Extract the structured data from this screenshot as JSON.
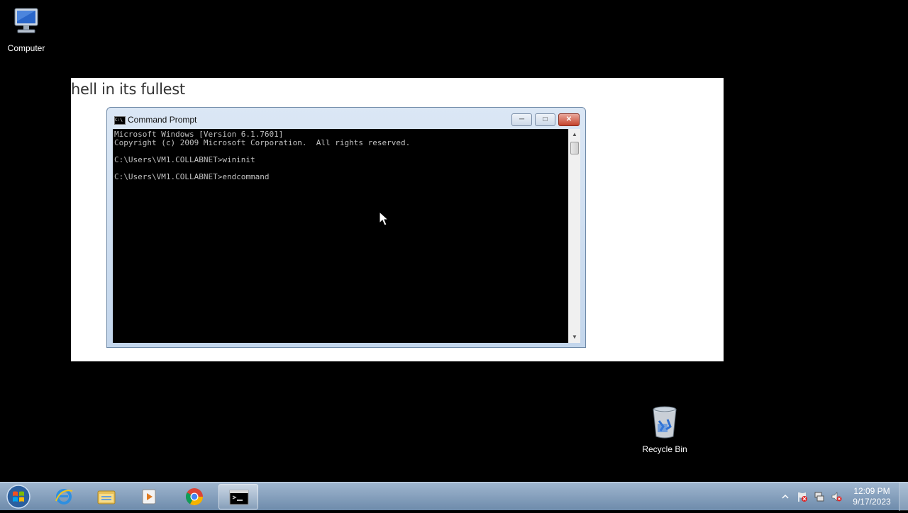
{
  "desktop": {
    "icons": [
      {
        "label": "Computer"
      },
      {
        "label": "Recycle Bin"
      }
    ]
  },
  "slide": {
    "heading": "hell in its fullest"
  },
  "cmd_window": {
    "title": "Command Prompt",
    "console_lines": [
      "Microsoft Windows [Version 6.1.7601]",
      "Copyright (c) 2009 Microsoft Corporation.  All rights reserved.",
      "",
      "C:\\Users\\VM1.COLLABNET>wininit",
      "",
      "C:\\Users\\VM1.COLLABNET>endcommand"
    ]
  },
  "taskbar": {
    "items": [
      "start",
      "internet-explorer",
      "windows-explorer",
      "media-player",
      "chrome",
      "command-prompt"
    ],
    "active_item": "command-prompt"
  },
  "clock": {
    "time": "12:09 PM",
    "date": "9/17/2023"
  },
  "colors": {
    "desktop_bg": "#000000",
    "console_bg": "#000000",
    "console_text": "#c0c0c0",
    "taskbar": "#7f9bbb"
  }
}
